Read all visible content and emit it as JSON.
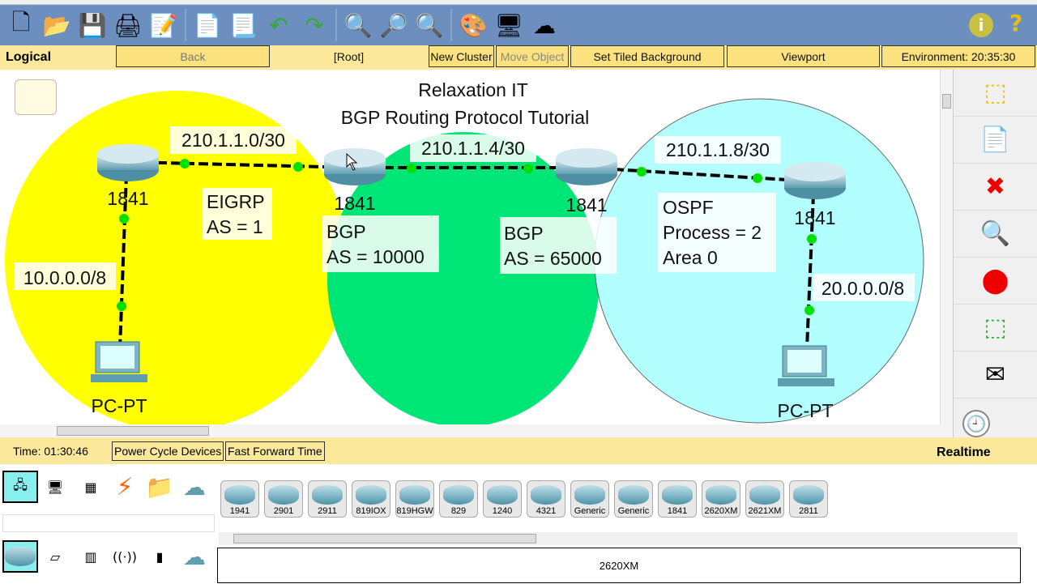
{
  "toolbar": {
    "icons": [
      "new-file-icon",
      "open-folder-icon",
      "save-icon",
      "print-icon",
      "activity-wizard-icon",
      "copy-icon",
      "paste-icon",
      "undo-icon",
      "redo-icon",
      "zoom-in-icon",
      "zoom-reset-icon",
      "zoom-out-icon",
      "palette-icon",
      "custom-device-icon",
      "cluster-icon"
    ],
    "info": "i",
    "help": "?"
  },
  "nav": {
    "logical": "Logical",
    "back": "Back",
    "root": "[Root]",
    "new_cluster": "New Cluster",
    "move_object": "Move Object",
    "tiled_bg": "Set Tiled Background",
    "viewport": "Viewport",
    "environment": "Environment: 20:35:30"
  },
  "canvas": {
    "title1": "Relaxation IT",
    "title2": "BGP Routing Protocol Tutorial",
    "net1": "210.1.1.0/30",
    "net2": "210.1.1.4/30",
    "net3": "210.1.1.8/30",
    "lan1": "10.0.0.0/8",
    "lan2": "20.0.0.0/8",
    "eigrp1": "EIGRP",
    "eigrp2": "AS = 1",
    "bgp1a": "BGP",
    "bgp1b": "AS = 10000",
    "bgp2a": "BGP",
    "bgp2b": "AS = 65000",
    "ospf1": "OSPF",
    "ospf2": "Process = 2",
    "ospf3": "Area 0",
    "routers": [
      "1841",
      "1841",
      "1841",
      "1841"
    ],
    "pcs": [
      "PC-PT",
      "PC-PT"
    ],
    "colors": {
      "zone_eigrp": "#ffff00",
      "zone_bgp": "#00e676",
      "zone_ospf": "#b3ffff",
      "link_up": "#00e000"
    }
  },
  "timebar": {
    "time": "Time: 01:30:46",
    "power_cycle": "Power Cycle Devices",
    "fast_forward": "Fast Forward Time",
    "realtime": "Realtime"
  },
  "devices": {
    "models": [
      "1941",
      "2901",
      "2911",
      "819IOX",
      "819HGW",
      "829",
      "1240",
      "4321",
      "Generic",
      "Generic",
      "1841",
      "2620XM",
      "2621XM",
      "2811"
    ],
    "selected_info": "2620XM"
  }
}
